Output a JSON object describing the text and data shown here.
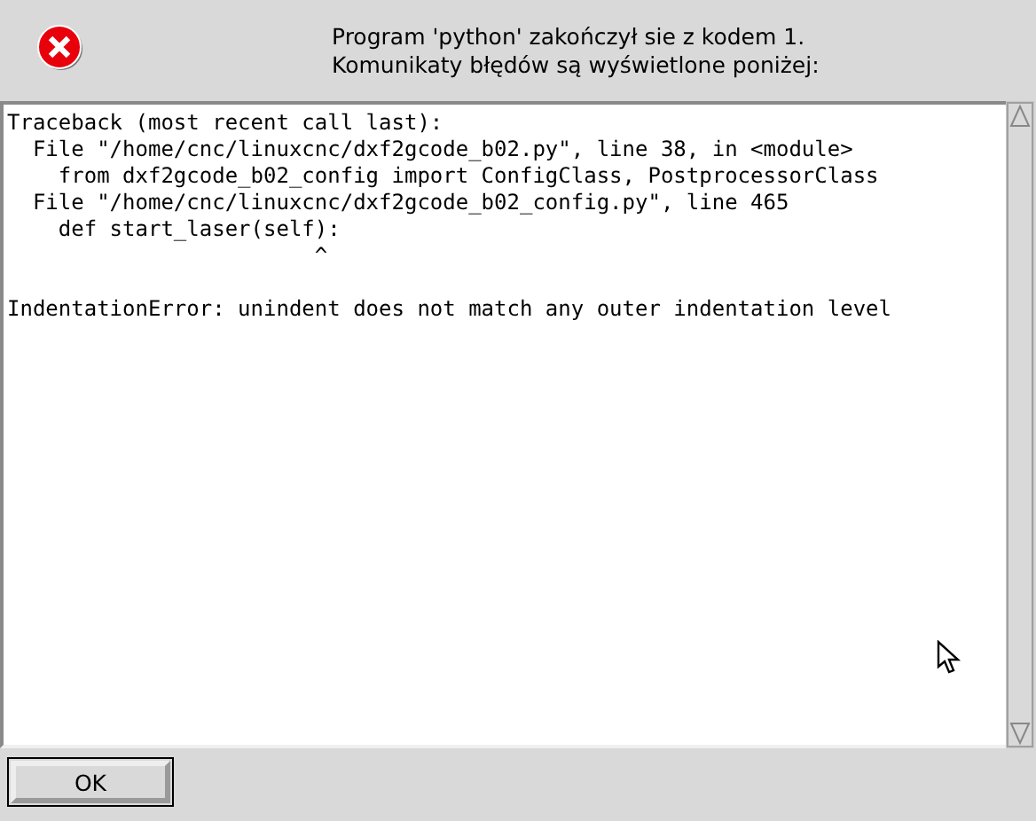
{
  "dialog": {
    "kind": "error",
    "message": "Program 'python' zakończył sie z kodem 1.\nKomunikaty błędów są wyświetlone poniżej:"
  },
  "output": "Traceback (most recent call last):\n  File \"/home/cnc/linuxcnc/dxf2gcode_b02.py\", line 38, in <module>\n    from dxf2gcode_b02_config import ConfigClass, PostprocessorClass\n  File \"/home/cnc/linuxcnc/dxf2gcode_b02_config.py\", line 465\n    def start_laser(self):\n                        ^\n\nIndentationError: unindent does not match any outer indentation level",
  "buttons": [
    {
      "label": "OK",
      "default": true
    }
  ]
}
